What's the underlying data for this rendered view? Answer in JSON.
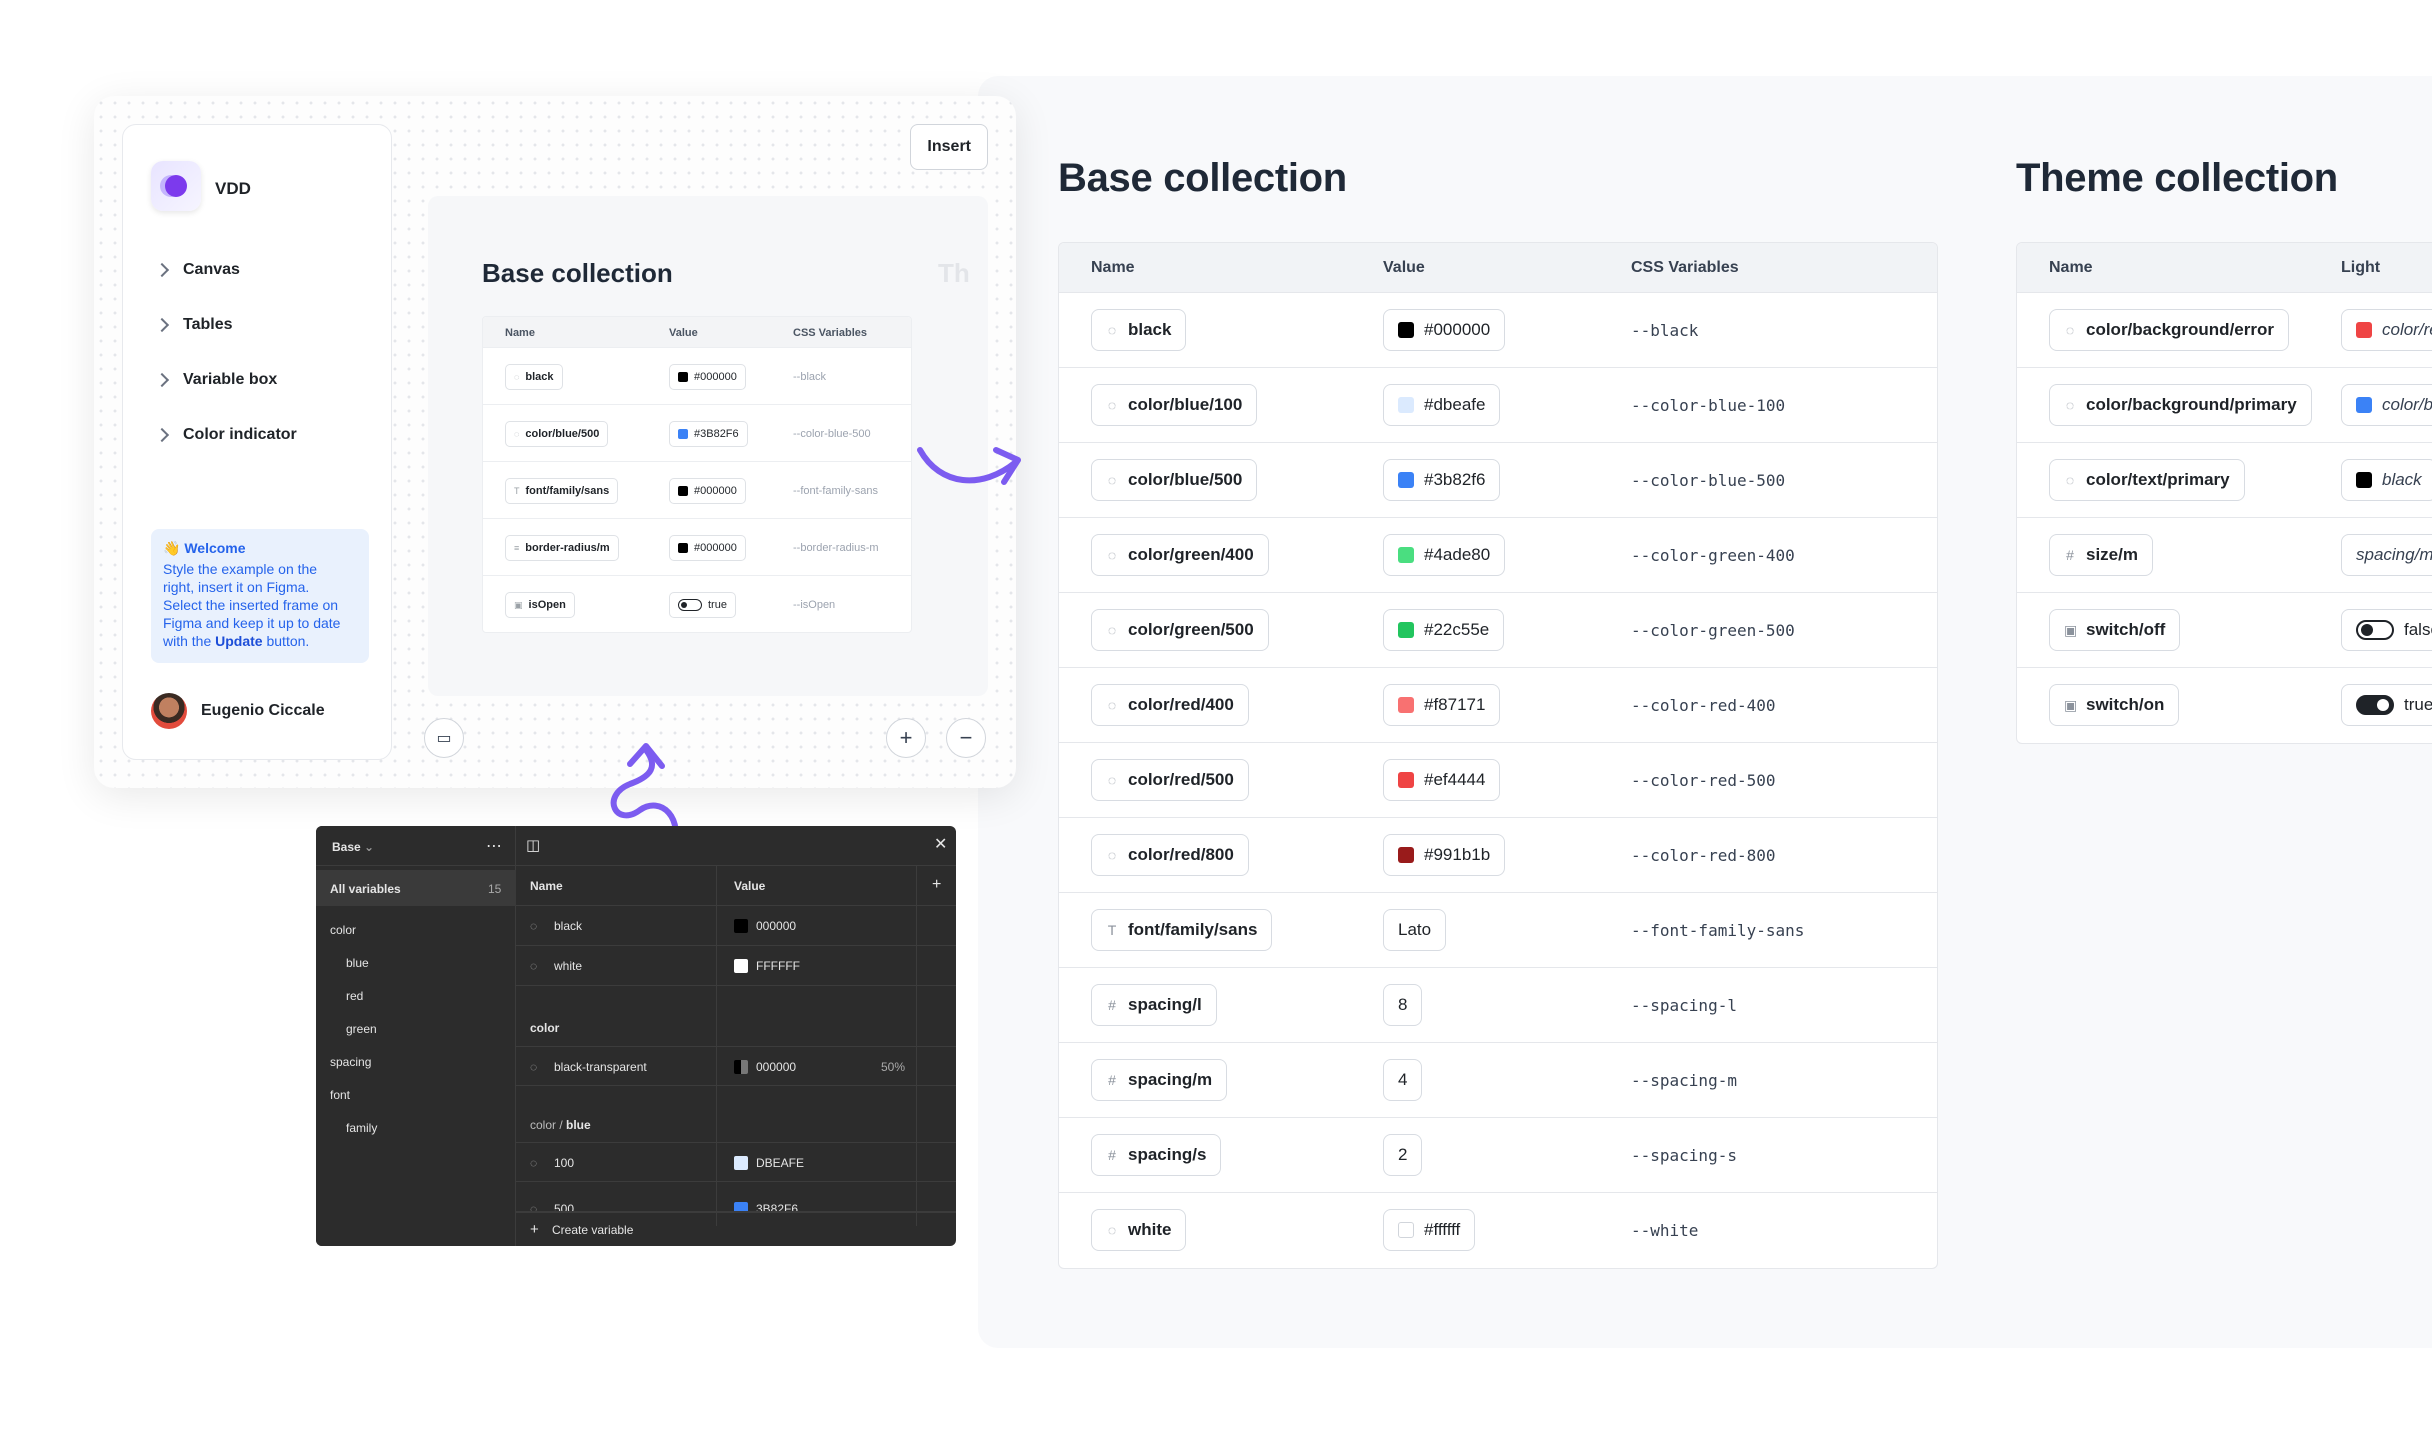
{
  "plugin": {
    "brand": "VDD",
    "insert_label": "Insert",
    "nav": [
      "Canvas",
      "Tables",
      "Variable box",
      "Color indicator"
    ],
    "welcome_title": "Welcome",
    "welcome_lines": [
      "Style the example on the",
      "right, insert it on Figma.",
      "Select the inserted frame on",
      "Figma and keep it up to date",
      "with the"
    ],
    "welcome_update": "Update",
    "welcome_tail": "button.",
    "user_name": "Eugenio Ciccale",
    "preview_title": "Base collection",
    "preview_ghost": "Th",
    "preview_headers": [
      "Name",
      "Value",
      "CSS Variables"
    ],
    "preview_rows": [
      {
        "name": "black",
        "value": "#000000",
        "css": "--black",
        "swatch": "#000000"
      },
      {
        "name": "color/blue/500",
        "value": "#3B82F6",
        "css": "--color-blue-500",
        "swatch": "#3b82f6"
      },
      {
        "name": "font/family/sans",
        "value": "#000000",
        "css": "--font-family-sans",
        "swatch": "#000000"
      },
      {
        "name": "border-radius/m",
        "value": "#000000",
        "css": "--border-radius-m",
        "swatch": "#000000"
      },
      {
        "name": "isOpen",
        "value": "true",
        "css": "--isOpen",
        "swatch": ""
      }
    ]
  },
  "figma": {
    "collection": "Base",
    "all_vars": "All variables",
    "count": "15",
    "groups": [
      "color",
      "blue",
      "red",
      "green",
      "spacing",
      "font",
      "family"
    ],
    "headers": [
      "Name",
      "Value"
    ],
    "rows": [
      {
        "name": "black",
        "value": "000000",
        "swatch": "#000000"
      },
      {
        "name": "white",
        "value": "FFFFFF",
        "swatch": "#ffffff"
      }
    ],
    "section_color": "color",
    "row_transparent": {
      "name": "black-transparent",
      "value": "000000",
      "opacity": "50%"
    },
    "section_blue_prefix": "color / ",
    "section_blue": "blue",
    "row_100": {
      "name": "100",
      "value": "DBEAFE",
      "swatch": "#dbeafe"
    },
    "row_500": {
      "name": "500",
      "value": "3B82F6",
      "swatch": "#3b82f6"
    },
    "create_label": "Create variable"
  },
  "base": {
    "title": "Base collection",
    "headers": [
      "Name",
      "Value",
      "CSS Variables"
    ],
    "rows": [
      {
        "icon": "color",
        "name": "black",
        "value": "#000000",
        "swatch": "#000000",
        "css": "--black"
      },
      {
        "icon": "color",
        "name": "color/blue/100",
        "value": "#dbeafe",
        "swatch": "#dbeafe",
        "css": "--color-blue-100"
      },
      {
        "icon": "color",
        "name": "color/blue/500",
        "value": "#3b82f6",
        "swatch": "#3b82f6",
        "css": "--color-blue-500"
      },
      {
        "icon": "color",
        "name": "color/green/400",
        "value": "#4ade80",
        "swatch": "#4ade80",
        "css": "--color-green-400"
      },
      {
        "icon": "color",
        "name": "color/green/500",
        "value": "#22c55e",
        "swatch": "#22c55e",
        "css": "--color-green-500"
      },
      {
        "icon": "color",
        "name": "color/red/400",
        "value": "#f87171",
        "swatch": "#f87171",
        "css": "--color-red-400"
      },
      {
        "icon": "color",
        "name": "color/red/500",
        "value": "#ef4444",
        "swatch": "#ef4444",
        "css": "--color-red-500"
      },
      {
        "icon": "color",
        "name": "color/red/800",
        "value": "#991b1b",
        "swatch": "#991b1b",
        "css": "--color-red-800"
      },
      {
        "icon": "text",
        "name": "font/family/sans",
        "value": "Lato",
        "swatch": "",
        "css": "--font-family-sans"
      },
      {
        "icon": "number",
        "name": "spacing/l",
        "value": "8",
        "swatch": "",
        "css": "--spacing-l"
      },
      {
        "icon": "number",
        "name": "spacing/m",
        "value": "4",
        "swatch": "",
        "css": "--spacing-m"
      },
      {
        "icon": "number",
        "name": "spacing/s",
        "value": "2",
        "swatch": "",
        "css": "--spacing-s"
      },
      {
        "icon": "color",
        "name": "white",
        "value": "#ffffff",
        "swatch": "#ffffff",
        "css": "--white"
      }
    ]
  },
  "theme": {
    "title": "Theme collection",
    "headers": [
      "Name",
      "Light"
    ],
    "rows": [
      {
        "icon": "color",
        "name": "color/background/error",
        "value": "color/re",
        "swatch": "#ef4444",
        "toggle": ""
      },
      {
        "icon": "color",
        "name": "color/background/primary",
        "value": "color/bl",
        "swatch": "#3b82f6",
        "toggle": ""
      },
      {
        "icon": "color",
        "name": "color/text/primary",
        "value": "black",
        "swatch": "#000000",
        "toggle": ""
      },
      {
        "icon": "number",
        "name": "size/m",
        "value": "spacing/m",
        "swatch": "",
        "toggle": ""
      },
      {
        "icon": "bool",
        "name": "switch/off",
        "value": "false",
        "swatch": "",
        "toggle": "off"
      },
      {
        "icon": "bool",
        "name": "switch/on",
        "value": "true",
        "swatch": "",
        "toggle": "on"
      }
    ]
  },
  "colors": {
    "accent": "#7c5cf0",
    "link": "#2563eb"
  }
}
